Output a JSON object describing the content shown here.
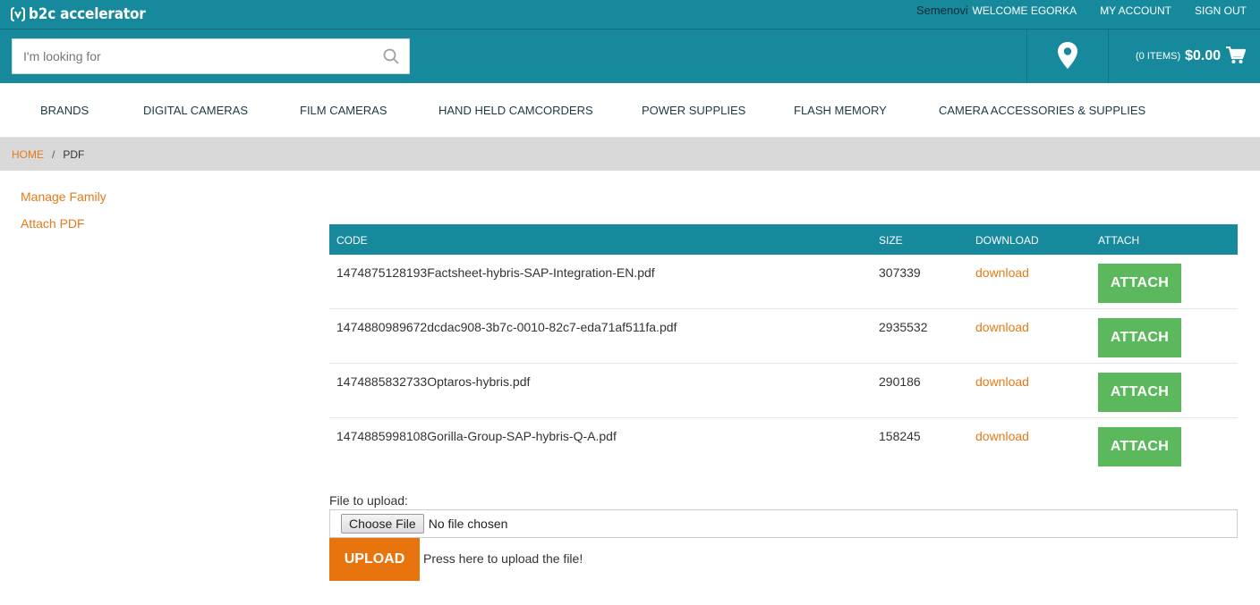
{
  "topbar": {
    "logo_text": "b2c accelerator",
    "username": "Semenovi",
    "links": [
      "WELCOME EGORKA",
      "MY ACCOUNT",
      "SIGN OUT"
    ]
  },
  "header": {
    "search_placeholder": "I'm looking for",
    "search_icon": "search-icon",
    "locator_icon": "map-pin-icon",
    "cart_items": "(0 ITEMS)",
    "cart_total": "$0.00",
    "cart_icon": "cart-icon"
  },
  "nav": {
    "items": [
      "BRANDS",
      "DIGITAL CAMERAS",
      "FILM CAMERAS",
      "HAND HELD CAMCORDERS",
      "POWER SUPPLIES",
      "FLASH MEMORY",
      "CAMERA ACCESSORIES & SUPPLIES"
    ]
  },
  "breadcrumb": {
    "home": "HOME",
    "separator": "/",
    "current": "PDF"
  },
  "sidebar": {
    "links": [
      "Manage Family",
      "Attach PDF"
    ]
  },
  "table": {
    "columns": [
      "CODE",
      "SIZE",
      "DOWNLOAD",
      "ATTACH"
    ],
    "rows": [
      {
        "code": "1474875128193Factsheet-hybris-SAP-Integration-EN.pdf",
        "size": "307339",
        "download": "download",
        "attach": "ATTACH"
      },
      {
        "code": "1474880989672dcdac908-3b7c-0010-82c7-eda71af511fa.pdf",
        "size": "2935532",
        "download": "download",
        "attach": "ATTACH"
      },
      {
        "code": "1474885832733Optaros-hybris.pdf",
        "size": "290186",
        "download": "download",
        "attach": "ATTACH"
      },
      {
        "code": "1474885998108Gorilla-Group-SAP-hybris-Q-A.pdf",
        "size": "158245",
        "download": "download",
        "attach": "ATTACH"
      }
    ]
  },
  "upload": {
    "label": "File to upload:",
    "choose_button": "Choose File",
    "file_status": "No file chosen",
    "upload_button": "UPLOAD",
    "hint": "Press here to upload the file!"
  },
  "colors": {
    "brand_teal": "#168a9c",
    "accent_orange": "#e57a18",
    "attach_green": "#5cb85c",
    "upload_orange": "#e8740e"
  }
}
